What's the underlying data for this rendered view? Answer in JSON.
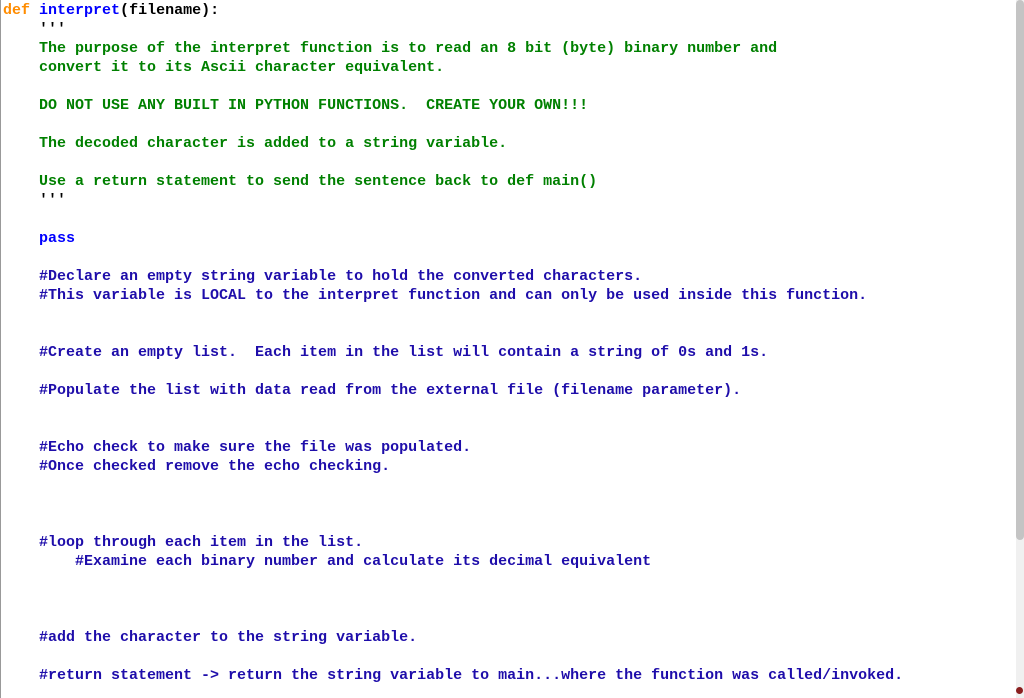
{
  "code": {
    "kw_def": "def",
    "fn_name": "interpret",
    "open_paren": "(",
    "param": "filename",
    "close_paren_colon": "):",
    "triple_q": "'''",
    "doc_line1": "The purpose of the interpret function is to read an 8 bit (byte) binary number and",
    "doc_line2": "convert it to its Ascii character equivalent.",
    "doc_line3": "DO NOT USE ANY BUILT IN PYTHON FUNCTIONS.  CREATE YOUR OWN!!!",
    "doc_line4": "The decoded character is added to a string variable.",
    "doc_line5": "Use a return statement to send the sentence back to def main()",
    "kw_pass": "pass",
    "c1": "#Declare an empty string variable to hold the converted characters.",
    "c2": "#This variable is LOCAL to the interpret function and can only be used inside this function.",
    "c3": "#Create an empty list.  Each item in the list will contain a string of 0s and 1s.",
    "c4": "#Populate the list with data read from the external file (filename parameter).",
    "c5": "#Echo check to make sure the file was populated.",
    "c6": "#Once checked remove the echo checking.",
    "c7": "#loop through each item in the list.",
    "c8": "#Examine each binary number and calculate its decimal equivalent",
    "c9": "#add the character to the string variable.",
    "c10": "#return statement -> return the string variable to main...where the function was called/invoked."
  },
  "scrollbar": {
    "thumb_top": 0,
    "thumb_height": 540
  }
}
